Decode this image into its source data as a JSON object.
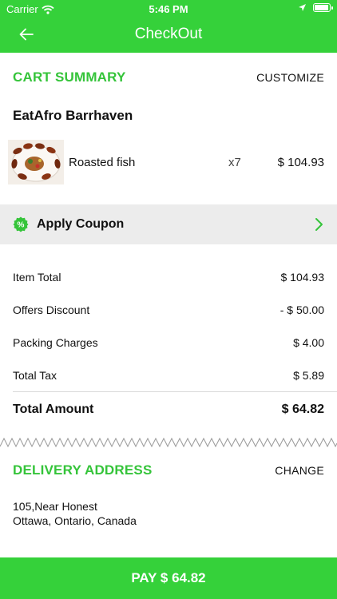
{
  "status_bar": {
    "carrier": "Carrier",
    "time": "5:46 PM"
  },
  "header": {
    "title": "CheckOut"
  },
  "cart": {
    "title": "CART SUMMARY",
    "action": "CUSTOMIZE",
    "restaurant": "EatAfro Barrhaven",
    "item": {
      "name": "Roasted fish",
      "qty": "x7",
      "price": "$ 104.93"
    }
  },
  "coupon": {
    "label": "Apply Coupon",
    "badge": "%"
  },
  "bill": {
    "rows": [
      {
        "label": "Item Total",
        "value": "$ 104.93"
      },
      {
        "label": "Offers Discount",
        "value": "- $ 50.00"
      },
      {
        "label": "Packing Charges",
        "value": "$ 4.00"
      },
      {
        "label": "Total Tax",
        "value": "$ 5.89"
      }
    ],
    "total_label": "Total Amount",
    "total_value": "$ 64.82"
  },
  "delivery": {
    "title": "DELIVERY ADDRESS",
    "action": "CHANGE",
    "line1": "105,Near Honest",
    "line2": "Ottawa, Ontario, Canada"
  },
  "pay_button": "PAY $ 64.82",
  "colors": {
    "accent": "#35d13a",
    "accent_text": "#35c43a",
    "coupon_bg": "#ececec"
  },
  "icons": [
    "wifi-icon",
    "location-arrow-icon",
    "battery-icon",
    "back-arrow-icon",
    "coupon-percent-icon",
    "chevron-right-icon"
  ]
}
